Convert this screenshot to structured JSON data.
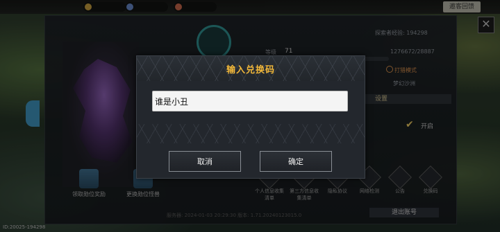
{
  "topbar": {
    "resources": [
      "",
      "",
      "",
      ""
    ],
    "right_button": "邀客回馈"
  },
  "profile": {
    "exp_label": "探索者经验: 194298",
    "level_label": "等级",
    "level_value": "71",
    "exp_progress": "1276672/28887",
    "mode_label": "打猎模式",
    "region_label": "梦幻沙洲",
    "setting_header": "设置",
    "toggle_label": "开启"
  },
  "left_actions": [
    {
      "label": "领取勋位奖励"
    },
    {
      "label": "更换勋位怪兽"
    }
  ],
  "menu_icons": [
    {
      "label": "个人信息收集清单"
    },
    {
      "label": "第三方信息收集清单"
    },
    {
      "label": "隐私协议"
    },
    {
      "label": "网络检测"
    },
    {
      "label": "公告"
    },
    {
      "label": "兑换码"
    }
  ],
  "logout_label": "退出账号",
  "footer_text": "服务器: 2024-01-03 20:29:30   版本: 1.71.20240123015.0",
  "corner_id": "ID:20025-194298",
  "dialog": {
    "title": "输入兑换码",
    "input_value": "谁是小丑",
    "cancel_label": "取消",
    "confirm_label": "确定"
  },
  "colors": {
    "title_gold": "#f2b83a",
    "input_bg": "#f4f4f4",
    "dialog_bg": "#23272d"
  }
}
